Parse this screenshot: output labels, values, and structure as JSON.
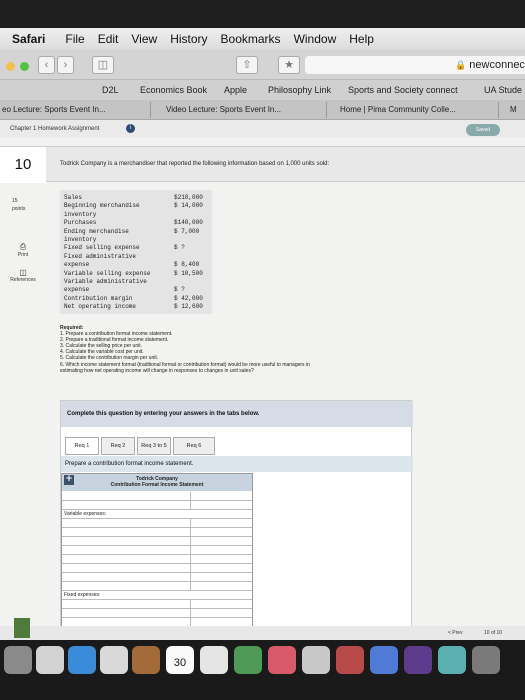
{
  "menubar": {
    "app": "Safari",
    "items": [
      "File",
      "Edit",
      "View",
      "History",
      "Bookmarks",
      "Window",
      "Help"
    ]
  },
  "toolbar": {
    "address": "newconnect."
  },
  "bookmarks": [
    "D2L",
    "Economics Book",
    "Apple",
    "Philosophy Link",
    "Sports and Society connect",
    "UA Stude"
  ],
  "tabs": [
    "eo Lecture: Sports Event In...",
    "Video Lecture: Sports Event In...",
    "Home | Pima Community Colle...",
    "M"
  ],
  "assignment": {
    "title": "Chapter 1 Homework Assignment",
    "saved": "Saved"
  },
  "question": {
    "number": "10",
    "text": "Todrick Company is a merchandiser that reported the following information based on 1,000 units sold:",
    "points_value": "15",
    "points_label": "points",
    "print_label": "Print",
    "reference_label": "References"
  },
  "data_table": [
    {
      "label": "Sales",
      "value": "$210,000"
    },
    {
      "label": "Beginning merchandise",
      "value": "$ 14,000"
    },
    {
      "label": "inventory",
      "value": ""
    },
    {
      "label": "Purchases",
      "value": "$140,000"
    },
    {
      "label": "Ending merchandise",
      "value": "$  7,000"
    },
    {
      "label": "inventory",
      "value": ""
    },
    {
      "label": "Fixed selling expense",
      "value": "$       ?"
    },
    {
      "label": "Fixed administrative",
      "value": ""
    },
    {
      "label": "expense",
      "value": "$  8,400"
    },
    {
      "label": "Variable selling expense",
      "value": "$ 10,500"
    },
    {
      "label": "Variable administrative",
      "value": ""
    },
    {
      "label": "expense",
      "value": "$       ?"
    },
    {
      "label": "Contribution margin",
      "value": "$ 42,000"
    },
    {
      "label": "Net operating income",
      "value": "$ 12,600"
    }
  ],
  "required": {
    "heading": "Required:",
    "items": [
      "1. Prepare a contribution format income statement.",
      "2. Prepare a traditional format income statement.",
      "3. Calculate the selling price per unit.",
      "4. Calculate the variable cost per unit.",
      "5. Calculate the contribution margin per unit.",
      "6. Which income statement format (traditional format or contribution format) would be more useful to managers in",
      "estimating how net operating income will change in responses to changes in unit sales?"
    ]
  },
  "panel": {
    "instruction": "Complete this question by entering your answers in the tabs below.",
    "tabs": [
      "Req 1",
      "Req 2",
      "Req 3 to 5",
      "Req 6"
    ],
    "prompt": "Prepare a contribution format income statement.",
    "statement_company": "Todrick Company",
    "statement_title": "Contribution Format Income Statement",
    "variable_label": "Variable expenses:",
    "fixed_label": "Fixed expenses:"
  },
  "pager": {
    "prev": "< Prev",
    "position": "10 of 10"
  },
  "dock": {
    "calendar_day": "30"
  }
}
